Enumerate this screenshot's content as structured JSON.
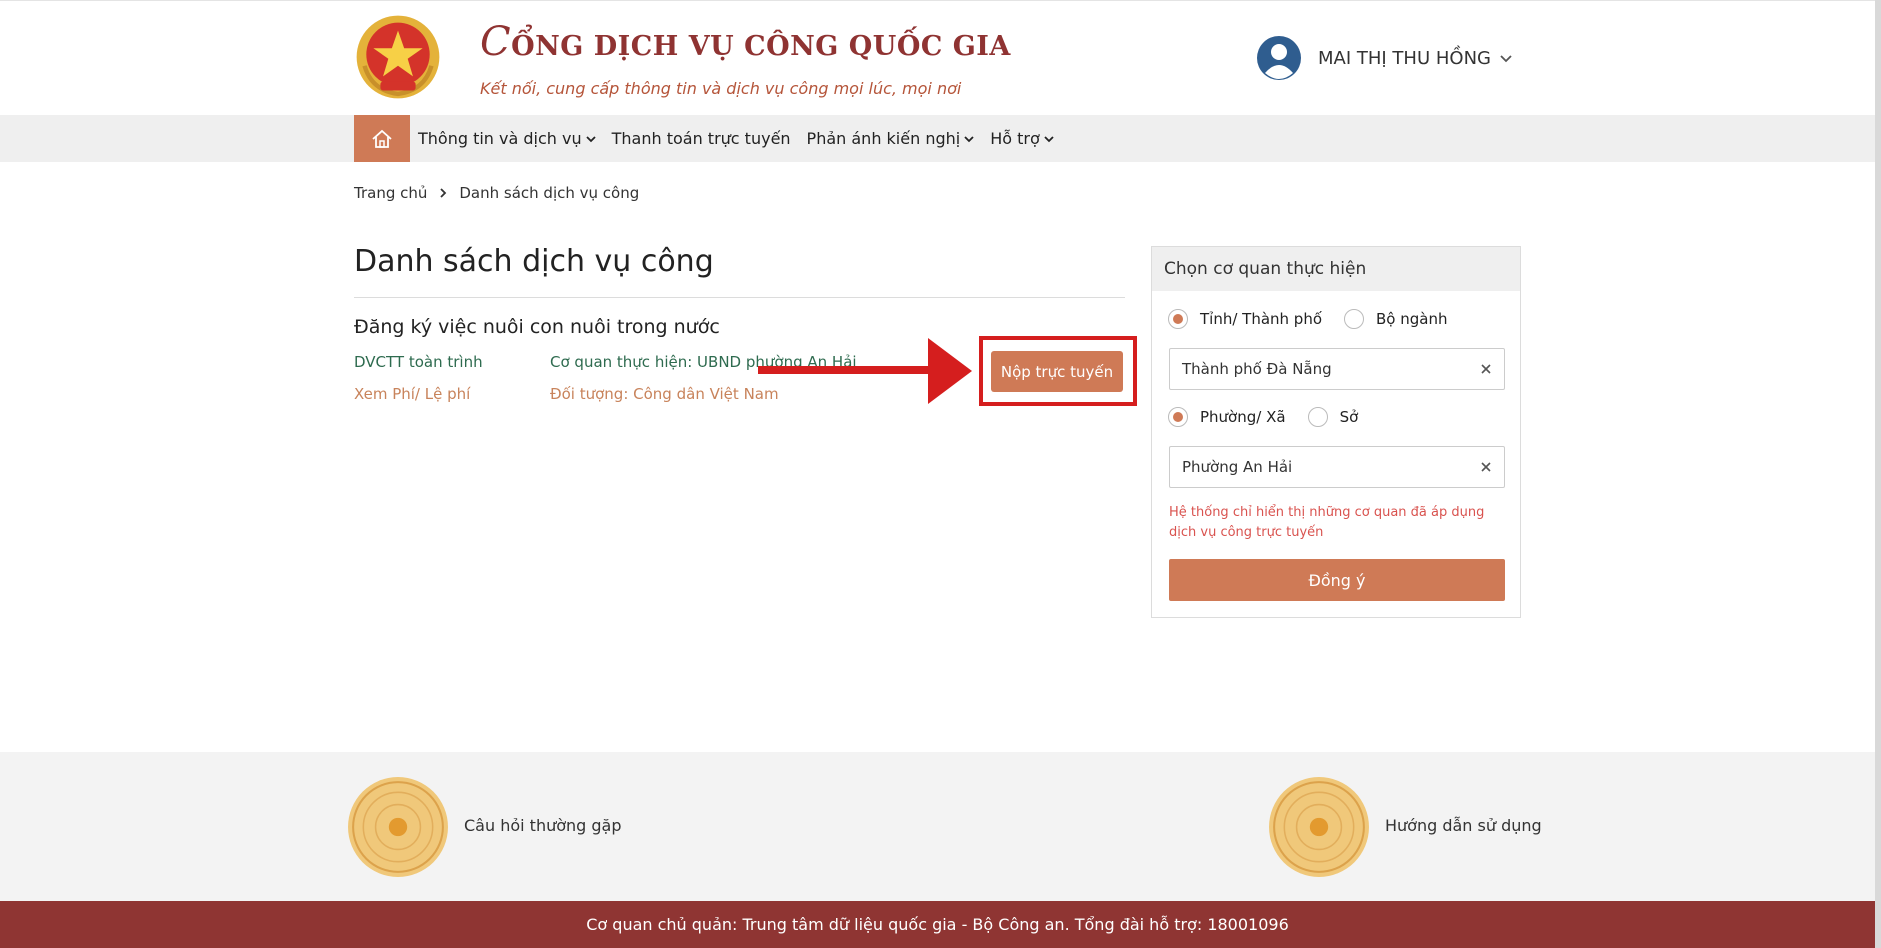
{
  "header": {
    "title_initial": "C",
    "title_rest": "ỔNG DỊCH VỤ CÔNG QUỐC GIA",
    "subtitle": "Kết nối, cung cấp thông tin và dịch vụ công mọi lúc, mọi nơi",
    "user_name": "MAI THỊ THU HỒNG",
    "emblem_icon": "national-emblem-icon",
    "avatar_icon": "user-avatar-icon"
  },
  "nav": {
    "home_icon": "home-icon",
    "items": [
      {
        "label": "Thông tin và dịch vụ",
        "has_dropdown": true
      },
      {
        "label": "Thanh toán trực tuyến",
        "has_dropdown": false
      },
      {
        "label": "Phản ánh kiến nghị",
        "has_dropdown": true
      },
      {
        "label": "Hỗ trợ",
        "has_dropdown": true
      }
    ]
  },
  "breadcrumb": {
    "home": "Trang chủ",
    "current": "Danh sách dịch vụ công"
  },
  "main": {
    "page_title": "Danh sách dịch vụ công",
    "service": {
      "title": "Đăng ký việc nuôi con nuôi trong nước",
      "type": "DVCTT toàn trình",
      "agency": "Cơ quan thực hiện: UBND phường An Hải",
      "fees": "Xem Phí/ Lệ phí",
      "target": "Đối tượng: Công dân Việt Nam",
      "submit_label": "Nộp trực tuyến"
    }
  },
  "panel": {
    "title": "Chọn cơ quan thực hiện",
    "level1": {
      "selected": "Tỉnh/ Thành phố",
      "other": "Bộ ngành"
    },
    "province_value": "Thành phố Đà Nẵng",
    "level2": {
      "selected": "Phường/ Xã",
      "other": "Sở"
    },
    "ward_value": "Phường An Hải",
    "note": "Hệ thống chỉ hiển thị những cơ quan đã áp dụng dịch vụ công trực tuyến",
    "agree_label": "Đồng ý"
  },
  "footer": {
    "faq": "Câu hỏi thường gặp",
    "guide": "Hướng dẫn sử dụng",
    "copyright": "Cơ quan chủ quản: Trung tâm dữ liệu quốc gia - Bộ Công an. Tổng đài hỗ trợ: 18001096"
  },
  "colors": {
    "brand": "#8f3332",
    "accent": "#cf7a56",
    "highlight": "#d51e1e",
    "link_green": "#2e6b4f",
    "link_orange": "#c8835b",
    "note_red": "#d9534f"
  }
}
